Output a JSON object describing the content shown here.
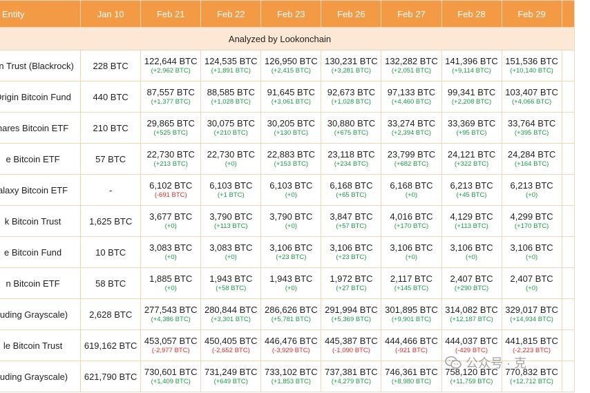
{
  "chart_data": {
    "type": "table",
    "subtitle": "Analyzed by Lookonchain",
    "columns": [
      "Entity",
      "Jan 10",
      "Feb 21",
      "Feb 22",
      "Feb 23",
      "Feb 26",
      "Feb 27",
      "Feb 28",
      "Feb 29"
    ],
    "rows": [
      {
        "entity": "oin Trust (Blackrock)",
        "jan10": "228 BTC",
        "cells": [
          [
            "122,644 BTC",
            "(+2,962 BTC)"
          ],
          [
            "124,535 BTC",
            "(+1,891 BTC)"
          ],
          [
            "126,950 BTC",
            "(+2,415 BTC)"
          ],
          [
            "130,231 BTC",
            "(+3,281 BTC)"
          ],
          [
            "132,282 BTC",
            "(+2,051 BTC)"
          ],
          [
            "141,396 BTC",
            "(+9,114 BTC)"
          ],
          [
            "151,536 BTC",
            "(+10,140 BTC)"
          ]
        ]
      },
      {
        "entity": "Origin Bitcoin Fund",
        "jan10": "440 BTC",
        "cells": [
          [
            "87,557 BTC",
            "(+1,377 BTC)"
          ],
          [
            "88,585 BTC",
            "(+1,028 BTC)"
          ],
          [
            "91,645 BTC",
            "(+3,061 BTC)"
          ],
          [
            "92,673 BTC",
            "(+1,028 BTC)"
          ],
          [
            "97,133 BTC",
            "(+4,460 BTC)"
          ],
          [
            "99,341 BTC",
            "(+2,208 BTC)"
          ],
          [
            "103,407 BTC",
            "(+4,066 BTC)"
          ]
        ]
      },
      {
        "entity": "hares Bitcoin ETF",
        "jan10": "210 BTC",
        "cells": [
          [
            "29,865 BTC",
            "(+525 BTC)"
          ],
          [
            "30,075 BTC",
            "(+210 BTC)"
          ],
          [
            "30,205 BTC",
            "(+130 BTC)"
          ],
          [
            "30,880 BTC",
            "(+675 BTC)"
          ],
          [
            "33,274 BTC",
            "(+2,394 BTC)"
          ],
          [
            "33,369 BTC",
            "(+95 BTC)"
          ],
          [
            "33,764 BTC",
            "(+395 BTC)"
          ]
        ]
      },
      {
        "entity": "e Bitcoin ETF",
        "jan10": "57 BTC",
        "cells": [
          [
            "22,730 BTC",
            "(+213 BTC)"
          ],
          [
            "22,730 BTC",
            "(+0)"
          ],
          [
            "22,883 BTC",
            "(+153 BTC)"
          ],
          [
            "23,118 BTC",
            "(+234 BTC)"
          ],
          [
            "23,799 BTC",
            "(+682 BTC)"
          ],
          [
            "24,121 BTC",
            "(+322 BTC)"
          ],
          [
            "24,284 BTC",
            "(+164 BTC)"
          ]
        ]
      },
      {
        "entity": "alaxy Bitcoin ETF",
        "jan10": "-",
        "cells": [
          [
            "6,102 BTC",
            "(-691 BTC)"
          ],
          [
            "6,103 BTC",
            "(+1 BTC)"
          ],
          [
            "6,103 BTC",
            "(+0)"
          ],
          [
            "6,168 BTC",
            "(+65 BTC)"
          ],
          [
            "6,168 BTC",
            "(+0)"
          ],
          [
            "6,213 BTC",
            "(+45 BTC)"
          ],
          [
            "6,213 BTC",
            "(+0)"
          ]
        ]
      },
      {
        "entity": "k Bitcoin Trust",
        "jan10": "1,625 BTC",
        "cells": [
          [
            "3,677 BTC",
            "(+0)"
          ],
          [
            "3,790 BTC",
            "(+113 BTC)"
          ],
          [
            "3,790 BTC",
            "(+0)"
          ],
          [
            "3,847 BTC",
            "(+57 BTC)"
          ],
          [
            "4,016 BTC",
            "(+170 BTC)"
          ],
          [
            "4,129 BTC",
            "(+113 BTC)"
          ],
          [
            "4,299 BTC",
            "(+170 BTC)"
          ]
        ]
      },
      {
        "entity": "e Bitcoin Fund",
        "jan10": "10 BTC",
        "cells": [
          [
            "3,083 BTC",
            "(+0)"
          ],
          [
            "3,083 BTC",
            "(+0)"
          ],
          [
            "3,106 BTC",
            "(+23 BTC)"
          ],
          [
            "3,106 BTC",
            "(+23 BTC)"
          ],
          [
            "3,106 BTC",
            "(+0)"
          ],
          [
            "3,106 BTC",
            "(+0)"
          ],
          [
            "3,106 BTC",
            "(+0)"
          ]
        ]
      },
      {
        "entity": "n Bitcoin ETF",
        "jan10": "58 BTC",
        "cells": [
          [
            "1,885 BTC",
            "(+0)"
          ],
          [
            "1,943 BTC",
            "(+58 BTC)"
          ],
          [
            "1,943 BTC",
            "(+0)"
          ],
          [
            "1,972 BTC",
            "(+27 BTC)"
          ],
          [
            "2,117 BTC",
            "(+145 BTC)"
          ],
          [
            "2,407 BTC",
            "(+290 BTC)"
          ],
          [
            "2,407 BTC",
            "(+0)"
          ]
        ]
      },
      {
        "entity": "luding Grayscale)",
        "jan10": "2,628 BTC",
        "cells": [
          [
            "277,543 BTC",
            "(+4,386 BTC)"
          ],
          [
            "280,844 BTC",
            "(+3,301 BTC)"
          ],
          [
            "286,626 BTC",
            "(+5,781 BTC)"
          ],
          [
            "291,994 BTC",
            "(+5,369 BTC)"
          ],
          [
            "301,895 BTC",
            "(+9,901 BTC)"
          ],
          [
            "314,082 BTC",
            "(+12,187 BTC)"
          ],
          [
            "329,017 BTC",
            "(+14,934 BTC)"
          ]
        ]
      },
      {
        "entity": "le Bitcoin Trust",
        "jan10": "619,162 BTC",
        "cells": [
          [
            "453,057 BTC",
            "(-2,977 BTC)"
          ],
          [
            "450,405 BTC",
            "(-2,652 BTC)"
          ],
          [
            "446,476 BTC",
            "(-3,929 BTC)"
          ],
          [
            "445,387 BTC",
            "(-1,090 BTC)"
          ],
          [
            "444,466 BTC",
            "(-921 BTC)"
          ],
          [
            "444,037 BTC",
            "(-429 BTC)"
          ],
          [
            "441,815 BTC",
            "(-2,223 BTC)"
          ]
        ]
      },
      {
        "entity": "luding Grayscale)",
        "jan10": "621,790 BTC",
        "cells": [
          [
            "730,601 BTC",
            "(+1,409 BTC)"
          ],
          [
            "731,249 BTC",
            "(+649 BTC)"
          ],
          [
            "733,102 BTC",
            "(+1,853 BTC)"
          ],
          [
            "737,381 BTC",
            "(+4,279 BTC)"
          ],
          [
            "746,361 BTC",
            "(+8,980 BTC)"
          ],
          [
            "758,120 BTC",
            "(+11,759 BTC)"
          ],
          [
            "770,832 BTC",
            "(+12,712 BTC)"
          ]
        ]
      }
    ]
  },
  "colors": {
    "header_bg": "#f39a45",
    "subheader_bg": "#fde8d5",
    "positive": "#1a9a46",
    "negative": "#e0292a"
  },
  "watermark": {
    "icon": "wechat-icon",
    "text": "公众号 · 克"
  }
}
